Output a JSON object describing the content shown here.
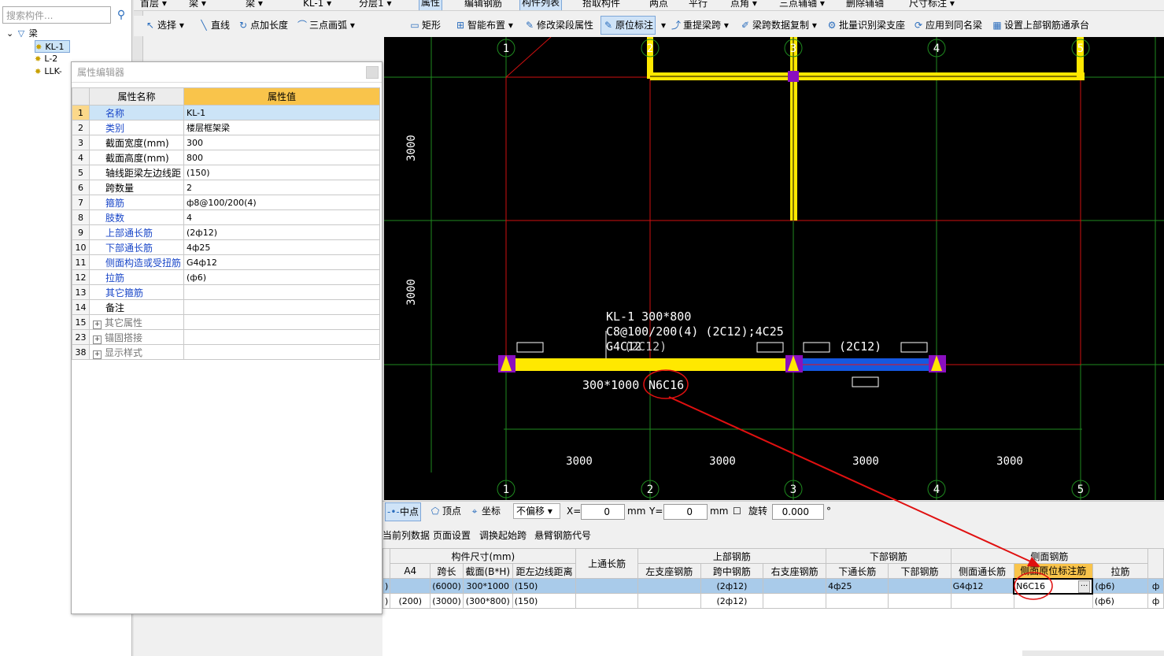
{
  "left": {
    "search_placeholder": "搜索构件...",
    "tree_root": "梁",
    "tree_items": [
      "KL-1",
      "L-2",
      "LLK-"
    ]
  },
  "toolbar1": {
    "items": [
      "首层",
      "梁",
      "梁",
      "KL-1",
      "分层1",
      "属性",
      "编辑钢筋",
      "构件列表",
      "拾取构件",
      "两点",
      "平行",
      "点角",
      "三点辅轴",
      "删除辅轴",
      "尺寸标注"
    ]
  },
  "toolbar2": {
    "items": [
      "选择",
      "直线",
      "点加长度",
      "三点画弧",
      "矩形",
      "智能布置",
      "修改梁段属性",
      "原位标注",
      "重提梁跨",
      "梁跨数据复制",
      "批量识别梁支座",
      "应用到同名梁",
      "设置上部钢筋通承台"
    ]
  },
  "prop_editor": {
    "title": "属性编辑器",
    "col_name": "属性名称",
    "col_value": "属性值",
    "rows": [
      {
        "num": "1",
        "name": "名称",
        "value": "KL-1"
      },
      {
        "num": "2",
        "name": "类别",
        "value": "楼层框架梁"
      },
      {
        "num": "3",
        "name": "截面宽度(mm)",
        "value": "300"
      },
      {
        "num": "4",
        "name": "截面高度(mm)",
        "value": "800"
      },
      {
        "num": "5",
        "name": "轴线距梁左边线距",
        "value": "(150)"
      },
      {
        "num": "6",
        "name": "跨数量",
        "value": "2"
      },
      {
        "num": "7",
        "name": "箍筋",
        "value": "ф8@100/200(4)"
      },
      {
        "num": "8",
        "name": "肢数",
        "value": "4"
      },
      {
        "num": "9",
        "name": "上部通长筋",
        "value": "(2ф12)"
      },
      {
        "num": "10",
        "name": "下部通长筋",
        "value": "4ф25"
      },
      {
        "num": "11",
        "name": "侧面构造或受扭筋",
        "value": "G4ф12"
      },
      {
        "num": "12",
        "name": "拉筋",
        "value": "(ф6)"
      },
      {
        "num": "13",
        "name": "其它箍筋",
        "value": ""
      },
      {
        "num": "14",
        "name": "备注",
        "value": ""
      },
      {
        "num": "15",
        "name": "其它属性",
        "value": ""
      },
      {
        "num": "23",
        "name": "锚固搭接",
        "value": ""
      },
      {
        "num": "38",
        "name": "显示样式",
        "value": ""
      }
    ]
  },
  "canvas": {
    "axis_labels": [
      "1",
      "2",
      "3",
      "4",
      "5"
    ],
    "dim_vertical": [
      "3000",
      "3000"
    ],
    "dim_horizontal": [
      "3000",
      "3000",
      "3000",
      "3000"
    ],
    "beam_label_lines": [
      "KL-1  300*800",
      "C8@100/200(4)  (2C12);4C25",
      "G4C12"
    ],
    "span2_top": "(2C12)",
    "span1_overlay": "(2C12)",
    "span1_bottom": "300*1000",
    "span1_side": "N6C16"
  },
  "snapbar": {
    "midpoint": "中点",
    "vertex": "顶点",
    "coord": "坐标",
    "offset_select": "不偏移",
    "x_label": "X=",
    "x_value": "0",
    "y_label": "Y=",
    "y_value": "0",
    "unit": "mm",
    "rotate_label": "旋转",
    "rotate_value": "0.000",
    "deg": "°"
  },
  "menubar2": {
    "items": [
      "当前列数据",
      "页面设置",
      "调换起始跨",
      "悬臂钢筋代号"
    ]
  },
  "grid": {
    "group_headers": [
      "构件尺寸(mm)",
      "上通长筋",
      "上部钢筋",
      "下部钢筋",
      "侧面钢筋"
    ],
    "sub_headers": [
      "A4",
      "跨长",
      "截面(B*H)",
      "距左边线距离",
      "左支座钢筋",
      "跨中钢筋",
      "右支座钢筋",
      "下通长筋",
      "下部钢筋",
      "侧面通长筋",
      "侧面原位标注筋",
      "拉筋"
    ],
    "rows": [
      {
        "c0": ")",
        "a4": "",
        "span": "(6000)",
        "sec": "300*1000",
        "dist": "(150)",
        "top": "",
        "left": "",
        "mid": "(2ф12)",
        "right": "",
        "botcont": "4ф25",
        "bot": "",
        "sidecont": "G4ф12",
        "side": "N6C16",
        "tie": "(ф6)",
        "last": "ф"
      },
      {
        "c0": ")",
        "a4": "(200)",
        "span": "(3000)",
        "sec": "(300*800)",
        "dist": "(150)",
        "top": "",
        "left": "",
        "mid": "(2ф12)",
        "right": "",
        "botcont": "",
        "bot": "",
        "sidecont": "",
        "side": "",
        "tie": "(ф6)",
        "last": "ф"
      }
    ]
  }
}
